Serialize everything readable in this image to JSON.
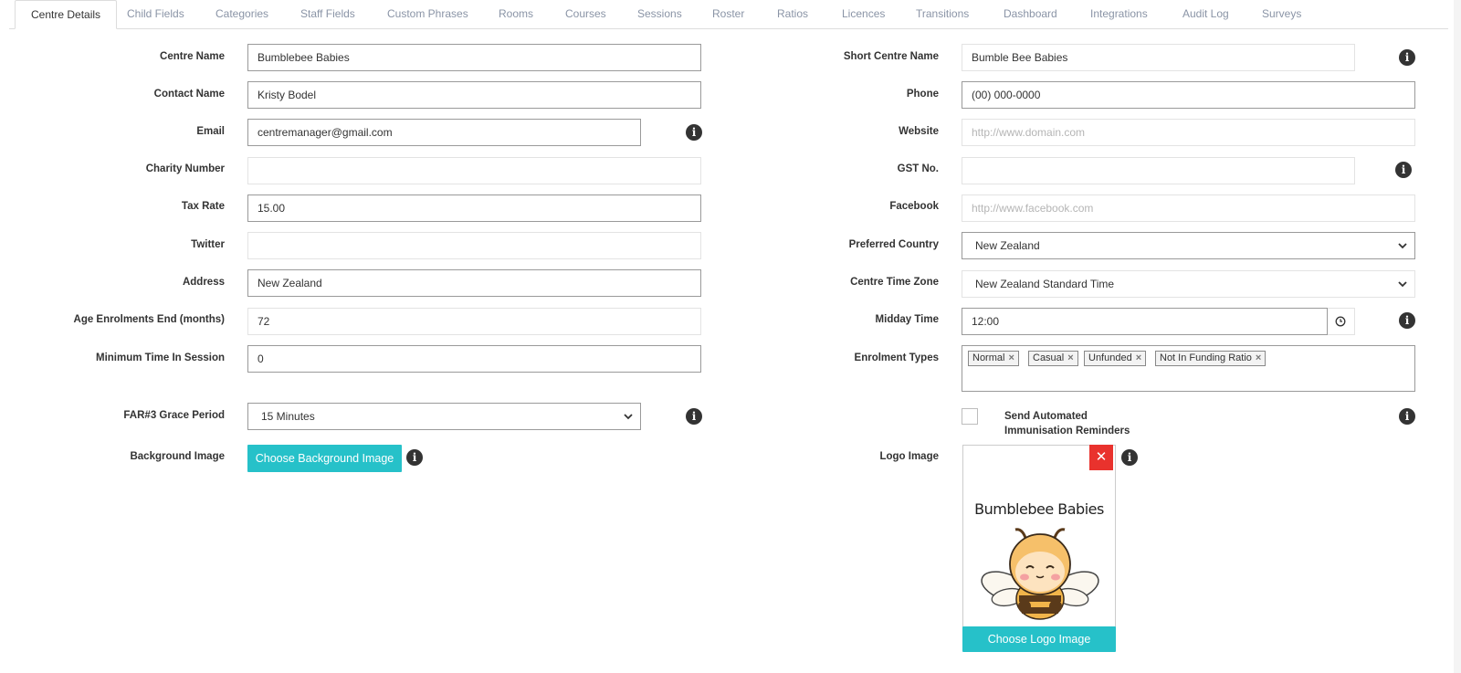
{
  "tabs": [
    {
      "label": "Centre Details",
      "active": true
    },
    {
      "label": "Child Fields"
    },
    {
      "label": "Categories"
    },
    {
      "label": "Staff Fields"
    },
    {
      "label": "Custom Phrases"
    },
    {
      "label": "Rooms"
    },
    {
      "label": "Courses"
    },
    {
      "label": "Sessions"
    },
    {
      "label": "Roster"
    },
    {
      "label": "Ratios"
    },
    {
      "label": "Licences"
    },
    {
      "label": "Transitions"
    },
    {
      "label": "Dashboard"
    },
    {
      "label": "Integrations"
    },
    {
      "label": "Audit Log"
    },
    {
      "label": "Surveys"
    }
  ],
  "left": {
    "centre_name": {
      "label": "Centre Name",
      "value": "Bumblebee Babies"
    },
    "contact_name": {
      "label": "Contact Name",
      "value": "Kristy Bodel"
    },
    "email": {
      "label": "Email",
      "value": "centremanager@gmail.com"
    },
    "charity_number": {
      "label": "Charity Number",
      "value": ""
    },
    "tax_rate": {
      "label": "Tax Rate",
      "value": "15.00"
    },
    "twitter": {
      "label": "Twitter",
      "value": ""
    },
    "address": {
      "label": "Address",
      "value": "New Zealand"
    },
    "age_enrolments_end": {
      "label": "Age Enrolments End (months)",
      "value": "72"
    },
    "minimum_time": {
      "label": "Minimum Time In Session",
      "value": "0"
    },
    "grace_period": {
      "label": "FAR#3 Grace Period",
      "value": "15 Minutes"
    },
    "background_image": {
      "label": "Background Image",
      "button": "Choose Background Image"
    }
  },
  "right": {
    "short_centre_name": {
      "label": "Short Centre Name",
      "value": "Bumble Bee Babies"
    },
    "phone": {
      "label": "Phone",
      "value": "(00) 000-0000"
    },
    "website": {
      "label": "Website",
      "placeholder": "http://www.domain.com"
    },
    "gst_no": {
      "label": "GST No.",
      "value": ""
    },
    "facebook": {
      "label": "Facebook",
      "placeholder": "http://www.facebook.com"
    },
    "preferred_country": {
      "label": "Preferred Country",
      "value": "New Zealand"
    },
    "centre_time_zone": {
      "label": "Centre Time Zone",
      "value": "New Zealand Standard Time"
    },
    "midday_time": {
      "label": "Midday Time",
      "value": "12:00"
    },
    "enrolment_types": {
      "label": "Enrolment Types",
      "tags": [
        "Normal",
        "Casual",
        "Unfunded",
        "Not In Funding Ratio"
      ]
    },
    "immunisation": {
      "label_line1": "Send Automated",
      "label_line2": "Immunisation Reminders",
      "checked": false
    },
    "logo_image": {
      "label": "Logo Image",
      "button": "Choose Logo Image",
      "logo_text": "Bumblebee Babies"
    }
  },
  "icons": {
    "info": "info-icon",
    "remove": "close-icon",
    "clock": "clock-icon",
    "dropdown": "chevron-down-icon"
  },
  "colors": {
    "accent": "#26c1c9",
    "danger": "#e9322d",
    "tab_inactive": "#8a94a6"
  }
}
